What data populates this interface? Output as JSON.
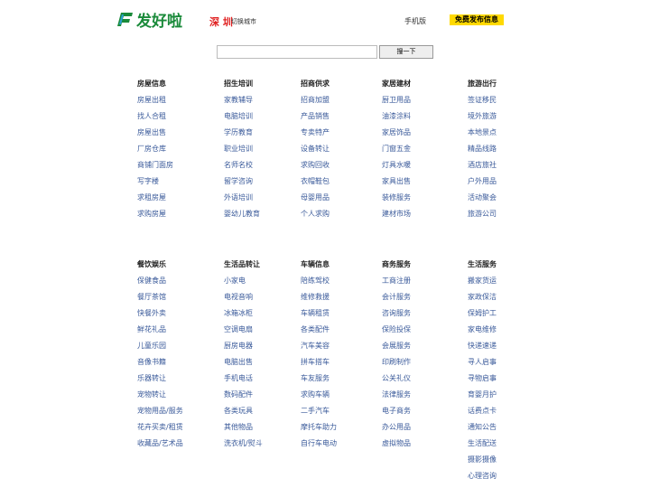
{
  "header": {
    "logo_text": "发好啦",
    "city": "深 圳",
    "switch_city": "切换城市",
    "mobile": "手机版",
    "publish": "免费发布信息"
  },
  "search": {
    "button": "搜一下",
    "placeholder": ""
  },
  "colors": {
    "brand_green": "#1a8a3a",
    "city_red": "#e02020",
    "publish_yellow": "#ffd900",
    "link_blue": "#3a5a9a"
  },
  "sections": [
    {
      "title": "房屋信息",
      "items": [
        "房屋出租",
        "找人合租",
        "房屋出售",
        "厂房仓库",
        "商铺门面房",
        "写字楼",
        "求租房屋",
        "求购房屋"
      ]
    },
    {
      "title": "招生培训",
      "items": [
        "家教辅导",
        "电脑培训",
        "学历教育",
        "职业培训",
        "名师名校",
        "留学咨询",
        "外语培训",
        "婴幼儿教育"
      ]
    },
    {
      "title": "招商供求",
      "items": [
        "招商加盟",
        "产品销售",
        "专卖特产",
        "设备转让",
        "求购回收",
        "衣帽鞋包",
        "母婴用品",
        "个人求购"
      ]
    },
    {
      "title": "家居建材",
      "items": [
        "厨卫用品",
        "油漆涂料",
        "家居饰品",
        "门窗五金",
        "灯具水暖",
        "家具出售",
        "装修服务",
        "建材市场"
      ]
    },
    {
      "title": "旅游出行",
      "items": [
        "签证移民",
        "境外旅游",
        "本地景点",
        "精品线路",
        "酒店旅社",
        "户外用品",
        "活动聚会",
        "旅游公司"
      ]
    },
    {
      "title": "餐饮娱乐",
      "items": [
        "保健食品",
        "餐厅茶馆",
        "快餐外卖",
        "鲜花礼品",
        "儿童乐园",
        "音像书籍",
        "乐器转让",
        "宠物转让",
        "宠物用品/服务",
        "花卉买卖/租赁",
        "收藏品/艺术品"
      ]
    },
    {
      "title": "生活品转让",
      "items": [
        "小家电",
        "电视音响",
        "冰箱冰柜",
        "空调电扇",
        "厨房电器",
        "电脑出售",
        "手机电话",
        "数码配件",
        "各类玩具",
        "其他物品",
        "洗衣机/熨斗"
      ]
    },
    {
      "title": "车辆信息",
      "items": [
        "陪练驾校",
        "维修救援",
        "车辆租赁",
        "各类配件",
        "汽车美容",
        "拼车搭车",
        "车友服务",
        "求购车辆",
        "二手汽车",
        "摩托车助力",
        "自行车电动"
      ]
    },
    {
      "title": "商务服务",
      "items": [
        "工商注册",
        "会计服务",
        "咨询服务",
        "保险投保",
        "会展服务",
        "印刷制作",
        "公关礼仪",
        "法律服务",
        "电子商务",
        "办公用品",
        "虚拟物品"
      ]
    },
    {
      "title": "生活服务",
      "items": [
        "搬家货运",
        "家政保洁",
        "保姆护工",
        "家电维修",
        "快递速递",
        "寻人启事",
        "寻物启事",
        "育婴月护",
        "话费点卡",
        "通知公告",
        "生活配送",
        "摄影摄像",
        "心理咨询"
      ]
    }
  ]
}
